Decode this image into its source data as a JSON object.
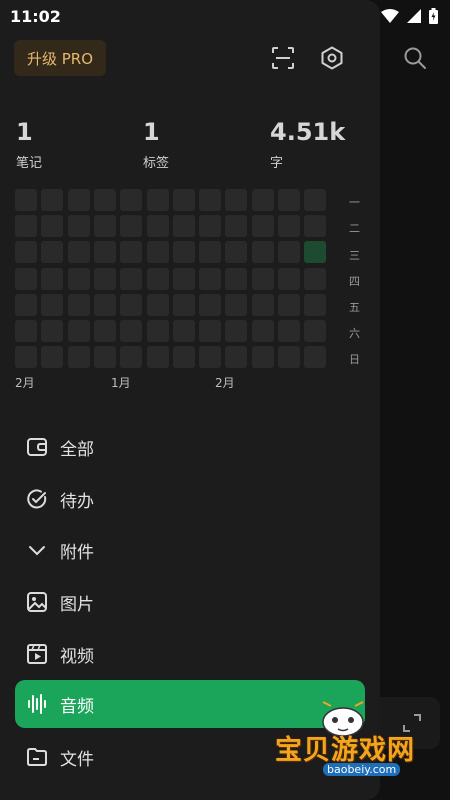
{
  "status_bar": {
    "time": "11:02"
  },
  "header": {
    "pro_label": "升级 PRO"
  },
  "stats": [
    {
      "value": "1",
      "label": "笔记"
    },
    {
      "value": "1",
      "label": "标签"
    },
    {
      "value": "4.51k",
      "label": "字"
    }
  ],
  "heatmap": {
    "weekdays": [
      "一",
      "二",
      "三",
      "四",
      "五",
      "六",
      "日"
    ],
    "months": [
      "2月",
      "1月",
      "2月"
    ],
    "active_color": "#1e4a32",
    "inactive_color": "#2a2a2a"
  },
  "menu": [
    {
      "label": "全部",
      "icon": "wallet-icon",
      "active": false
    },
    {
      "label": "待办",
      "icon": "check-circle-icon",
      "active": false
    },
    {
      "label": "附件",
      "icon": "chevron-down-icon",
      "active": false
    },
    {
      "label": "图片",
      "icon": "image-icon",
      "active": false
    },
    {
      "label": "视频",
      "icon": "video-icon",
      "active": false
    },
    {
      "label": "音频",
      "icon": "audio-wave-icon",
      "active": true
    },
    {
      "label": "文件",
      "icon": "folder-icon",
      "active": false
    }
  ],
  "colors": {
    "accent": "#1aa55a",
    "pro_text": "#e7b86c",
    "pro_bg": "#33291b"
  },
  "watermark": {
    "title": "宝贝游戏网",
    "url": "baobeiy.com"
  }
}
